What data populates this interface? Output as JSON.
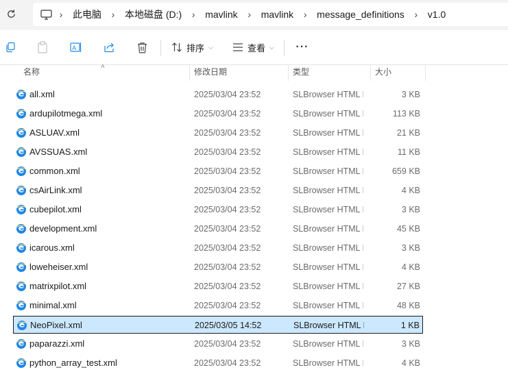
{
  "breadcrumb": [
    "此电脑",
    "本地磁盘 (D:)",
    "mavlink",
    "mavlink",
    "message_definitions",
    "v1.0"
  ],
  "toolbar": {
    "sort_label": "排序",
    "view_label": "查看",
    "more_label": "···"
  },
  "columns": {
    "name": "名称",
    "date": "修改日期",
    "type": "类型",
    "size": "大小"
  },
  "files": [
    {
      "name": "all.xml",
      "date": "2025/03/04 23:52",
      "type": "SLBrowser HTML Document",
      "size": "3 KB"
    },
    {
      "name": "ardupilotmega.xml",
      "date": "2025/03/04 23:52",
      "type": "SLBrowser HTML Document",
      "size": "113 KB"
    },
    {
      "name": "ASLUAV.xml",
      "date": "2025/03/04 23:52",
      "type": "SLBrowser HTML Document",
      "size": "21 KB"
    },
    {
      "name": "AVSSUAS.xml",
      "date": "2025/03/04 23:52",
      "type": "SLBrowser HTML Document",
      "size": "11 KB"
    },
    {
      "name": "common.xml",
      "date": "2025/03/04 23:52",
      "type": "SLBrowser HTML Document",
      "size": "659 KB"
    },
    {
      "name": "csAirLink.xml",
      "date": "2025/03/04 23:52",
      "type": "SLBrowser HTML Document",
      "size": "4 KB"
    },
    {
      "name": "cubepilot.xml",
      "date": "2025/03/04 23:52",
      "type": "SLBrowser HTML Document",
      "size": "3 KB"
    },
    {
      "name": "development.xml",
      "date": "2025/03/04 23:52",
      "type": "SLBrowser HTML Document",
      "size": "45 KB"
    },
    {
      "name": "icarous.xml",
      "date": "2025/03/04 23:52",
      "type": "SLBrowser HTML Document",
      "size": "3 KB"
    },
    {
      "name": "loweheiser.xml",
      "date": "2025/03/04 23:52",
      "type": "SLBrowser HTML Document",
      "size": "4 KB"
    },
    {
      "name": "matrixpilot.xml",
      "date": "2025/03/04 23:52",
      "type": "SLBrowser HTML Document",
      "size": "27 KB"
    },
    {
      "name": "minimal.xml",
      "date": "2025/03/04 23:52",
      "type": "SLBrowser HTML Document",
      "size": "48 KB"
    },
    {
      "name": "NeoPixel.xml",
      "date": "2025/03/05 14:52",
      "type": "SLBrowser HTML Document",
      "size": "1 KB",
      "selected": true
    },
    {
      "name": "paparazzi.xml",
      "date": "2025/03/04 23:52",
      "type": "SLBrowser HTML Document",
      "size": "3 KB"
    },
    {
      "name": "python_array_test.xml",
      "date": "2025/03/04 23:52",
      "type": "SLBrowser HTML Document",
      "size": "4 KB"
    }
  ],
  "colors": {
    "selection_bg": "#cce8ff",
    "selection_border": "#1b1b1b",
    "icon_blue": "#1e88e5"
  }
}
